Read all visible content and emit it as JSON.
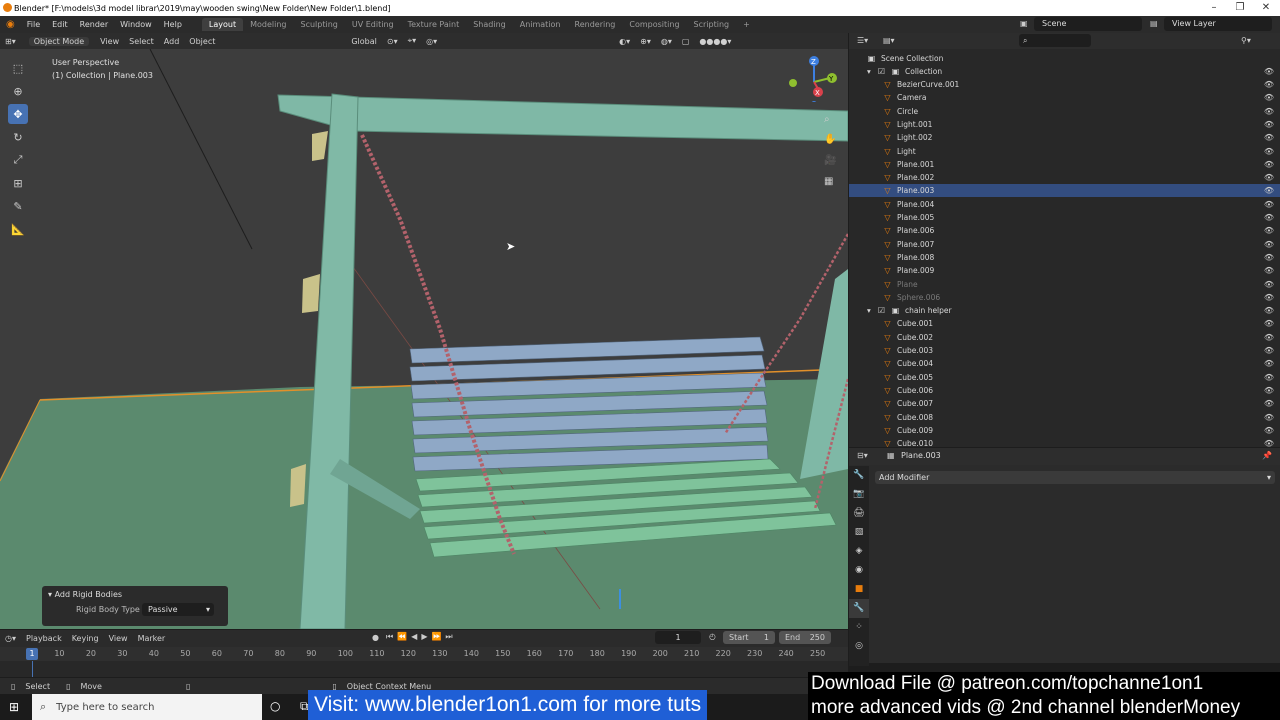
{
  "window": {
    "title": "Blender* [F:\\models\\3d model librar\\2019\\may\\wooden swing\\New Folder\\New Folder\\1.blend]"
  },
  "menu": [
    "File",
    "Edit",
    "Render",
    "Window",
    "Help"
  ],
  "workspaces": [
    "Layout",
    "Modeling",
    "Sculpting",
    "UV Editing",
    "Texture Paint",
    "Shading",
    "Animation",
    "Rendering",
    "Compositing",
    "Scripting"
  ],
  "active_workspace": "Layout",
  "scene": "Scene",
  "view_layer": "View Layer",
  "viewport_header": {
    "mode": "Object Mode",
    "menus": [
      "View",
      "Select",
      "Add",
      "Object"
    ],
    "orientation": "Global"
  },
  "viewport": {
    "perspective": "User Perspective",
    "context": "(1) Collection | Plane.003",
    "gizmo_axes": [
      "Z",
      "Y",
      "X"
    ]
  },
  "operator_panel": {
    "title": "Add Rigid Bodies",
    "label": "Rigid Body Type",
    "value": "Passive"
  },
  "outliner": {
    "root": "Scene Collection",
    "collection": "Collection",
    "items": [
      {
        "name": "BezierCurve.001",
        "selected": false,
        "dim": false
      },
      {
        "name": "Camera",
        "selected": false,
        "dim": false
      },
      {
        "name": "Circle",
        "selected": false,
        "dim": false
      },
      {
        "name": "Light.001",
        "selected": false,
        "dim": false
      },
      {
        "name": "Light.002",
        "selected": false,
        "dim": false
      },
      {
        "name": "Light",
        "selected": false,
        "dim": false
      },
      {
        "name": "Plane.001",
        "selected": false,
        "dim": false
      },
      {
        "name": "Plane.002",
        "selected": false,
        "dim": false
      },
      {
        "name": "Plane.003",
        "selected": true,
        "dim": false
      },
      {
        "name": "Plane.004",
        "selected": false,
        "dim": false
      },
      {
        "name": "Plane.005",
        "selected": false,
        "dim": false
      },
      {
        "name": "Plane.006",
        "selected": false,
        "dim": false
      },
      {
        "name": "Plane.007",
        "selected": false,
        "dim": false
      },
      {
        "name": "Plane.008",
        "selected": false,
        "dim": false
      },
      {
        "name": "Plane.009",
        "selected": false,
        "dim": false
      },
      {
        "name": "Plane",
        "selected": false,
        "dim": true
      },
      {
        "name": "Sphere.006",
        "selected": false,
        "dim": true
      }
    ],
    "collection2": "chain helper",
    "items2": [
      "Cube.001",
      "Cube.002",
      "Cube.003",
      "Cube.004",
      "Cube.005",
      "Cube.006",
      "Cube.007",
      "Cube.008",
      "Cube.009",
      "Cube.010"
    ]
  },
  "properties": {
    "object": "Plane.003",
    "add_modifier": "Add Modifier"
  },
  "timeline": {
    "menus": [
      "Playback",
      "Keying",
      "View",
      "Marker"
    ],
    "current_frame": "1",
    "start_label": "Start",
    "start": "1",
    "end_label": "End",
    "end": "250",
    "playhead": "1",
    "ticks": [
      "10",
      "20",
      "30",
      "40",
      "50",
      "60",
      "70",
      "80",
      "90",
      "100",
      "110",
      "120",
      "130",
      "140",
      "150",
      "160",
      "170",
      "180",
      "190",
      "200",
      "210",
      "220",
      "230",
      "240",
      "250"
    ]
  },
  "statusbar": {
    "select": "Select",
    "move": "Move",
    "context_menu": "Object Context Menu"
  },
  "taskbar": {
    "search_placeholder": "Type here to search"
  },
  "overlays": {
    "visit": "Visit: www.blender1on1.com for more tuts",
    "download": "Download File  @ patreon.com/topchanne1on1",
    "more": "more advanced vids @ 2nd channel  blenderMoney"
  },
  "colors": {
    "selection": "#334d80",
    "accent_blue": "#4772b3",
    "object_orange": "#e87d0d",
    "overlay_blue": "#1f5fd6"
  }
}
